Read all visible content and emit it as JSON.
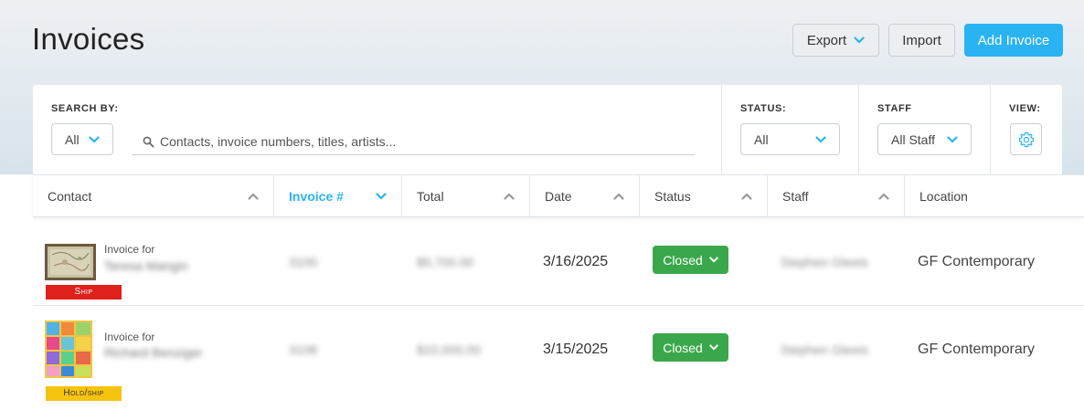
{
  "header": {
    "title": "Invoices",
    "export_label": "Export",
    "import_label": "Import",
    "add_label": "Add Invoice"
  },
  "filters": {
    "search_by_label": "SEARCH BY:",
    "search_by_value": "All",
    "search_placeholder": "Contacts, invoice numbers, titles, artists...",
    "status_label": "STATUS:",
    "status_value": "All",
    "staff_label": "STAFF",
    "staff_value": "All Staff",
    "view_label": "VIEW:"
  },
  "table": {
    "columns": [
      {
        "label": "Contact",
        "sorted": false
      },
      {
        "label": "Invoice #",
        "sorted": true
      },
      {
        "label": "Total",
        "sorted": false
      },
      {
        "label": "Date",
        "sorted": false
      },
      {
        "label": "Status",
        "sorted": false
      },
      {
        "label": "Staff",
        "sorted": false
      },
      {
        "label": "Location",
        "sorted": false
      }
    ],
    "rows": [
      {
        "invoice_for": "Invoice for",
        "contact": "Teresa Mangin",
        "tag": "Ship",
        "invoice_no": "3100",
        "total": "$5,700.00",
        "date": "3/16/2025",
        "status": "Closed",
        "staff": "Stephen Gleeis",
        "location": "GF Contemporary"
      },
      {
        "invoice_for": "Invoice for",
        "contact": "Richard Benziger",
        "tag": "Hold/ship",
        "invoice_no": "3108",
        "total": "$10,000.00",
        "date": "3/15/2025",
        "status": "Closed",
        "staff": "Stephen Gleeis",
        "location": "GF Contemporary"
      }
    ]
  },
  "colors": {
    "accent": "#2ab3f2",
    "status_closed": "#3aa84a",
    "tag_ship": "#e0201b",
    "tag_hold": "#f6c30f"
  }
}
